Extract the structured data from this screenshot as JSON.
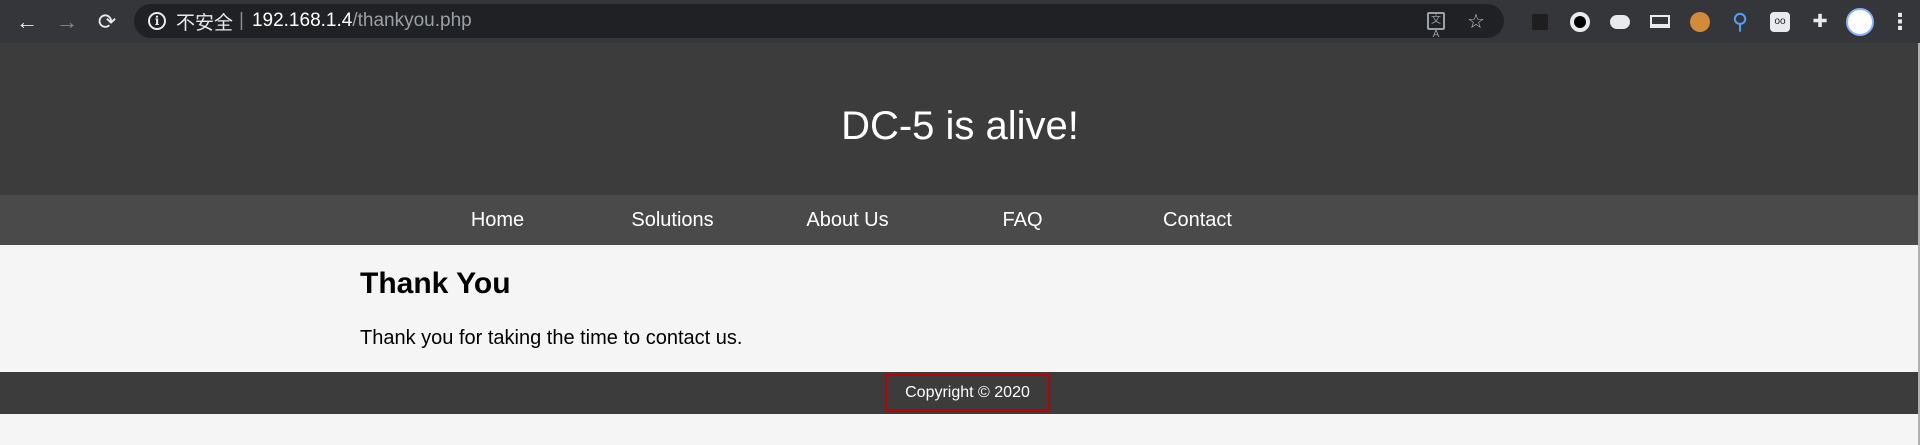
{
  "browser": {
    "back_icon": "←",
    "forward_icon": "→",
    "reload_icon": "⟳",
    "info_icon": "i",
    "security_label": "不安全",
    "separator": "|",
    "url_host": "192.168.1.4",
    "url_path": "/thankyou.php",
    "translate_icon": "文A",
    "star_icon": "☆",
    "extensions_icon": "✚",
    "menu_icon": "⋮"
  },
  "site": {
    "title": "DC-5 is alive!",
    "nav": [
      "Home",
      "Solutions",
      "About Us",
      "FAQ",
      "Contact"
    ]
  },
  "main": {
    "heading": "Thank You",
    "message": "Thank you for taking the time to contact us."
  },
  "footer": {
    "copyright": "Copyright © 2020",
    "highlight_color": "#c00000"
  },
  "colors": {
    "header_bg": "#3c3c3c",
    "nav_bg": "#4a4a4a",
    "page_bg": "#f5f5f5",
    "chrome_bg": "#35363a"
  }
}
